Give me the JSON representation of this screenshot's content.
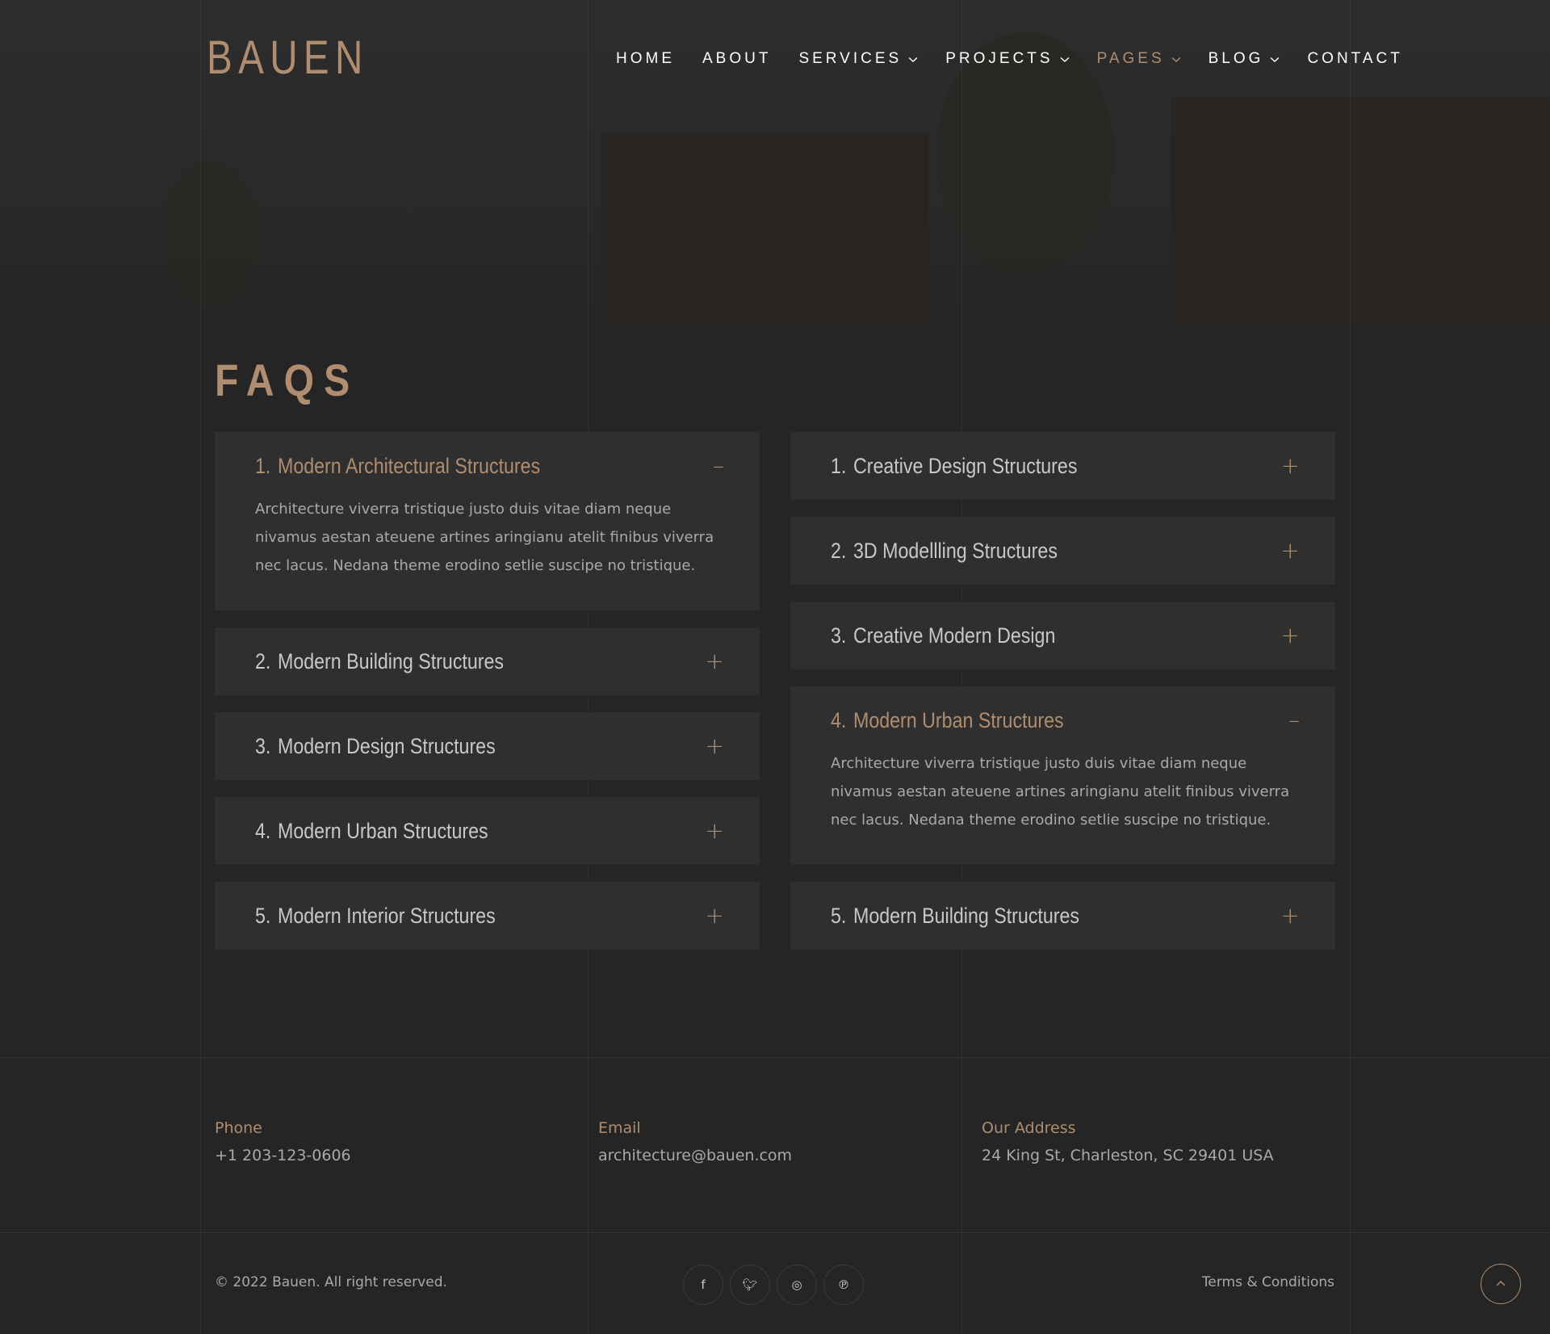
{
  "brand": {
    "logo": "BAUEN",
    "accent_color": "#b08d6e",
    "background_color": "#252525"
  },
  "nav": {
    "items": [
      {
        "label": "HOME",
        "has_dropdown": false,
        "active": false
      },
      {
        "label": "ABOUT",
        "has_dropdown": false,
        "active": false
      },
      {
        "label": "SERVICES",
        "has_dropdown": true,
        "active": false
      },
      {
        "label": "PROJECTS",
        "has_dropdown": true,
        "active": false
      },
      {
        "label": "PAGES",
        "has_dropdown": true,
        "active": true
      },
      {
        "label": "BLOG",
        "has_dropdown": true,
        "active": false
      },
      {
        "label": "CONTACT",
        "has_dropdown": false,
        "active": false
      }
    ],
    "dropdown_icon": "chevron-down-icon"
  },
  "faqs": {
    "title": "FAQS",
    "answer_text": "Architecture viverra tristique justo duis vitae diam neque nivamus aestan ateuene artines aringianu atelit finibus viverra nec lacus. Nedana theme erodino setlie suscipe no tristique.",
    "left": [
      {
        "num": "1.",
        "question": "Modern Architectural Structures",
        "open": true,
        "toggle": "–"
      },
      {
        "num": "2.",
        "question": "Modern Building Structures",
        "open": false,
        "toggle": "+"
      },
      {
        "num": "3.",
        "question": "Modern Design Structures",
        "open": false,
        "toggle": "+"
      },
      {
        "num": "4.",
        "question": "Modern Urban Structures",
        "open": false,
        "toggle": "+"
      },
      {
        "num": "5.",
        "question": "Modern Interior Structures",
        "open": false,
        "toggle": "+"
      }
    ],
    "right": [
      {
        "num": "1.",
        "question": "Creative Design Structures",
        "open": false,
        "toggle": "+"
      },
      {
        "num": "2.",
        "question": "3D Modellling Structures",
        "open": false,
        "toggle": "+"
      },
      {
        "num": "3.",
        "question": "Creative Modern Design",
        "open": false,
        "toggle": "+"
      },
      {
        "num": "4.",
        "question": "Modern Urban Structures",
        "open": true,
        "toggle": "–"
      },
      {
        "num": "5.",
        "question": "Modern Building Structures",
        "open": false,
        "toggle": "+"
      }
    ]
  },
  "footer": {
    "phone": {
      "label": "Phone",
      "value": "+1 203-123-0606"
    },
    "email": {
      "label": "Email",
      "value": "architecture@bauen.com"
    },
    "address": {
      "label": "Our Address",
      "value": "24  King St, Charleston, SC 29401 USA"
    },
    "copyright": "© 2022  Bauen. All right reserved.",
    "socials": [
      {
        "icon": "facebook-icon",
        "glyph": "f"
      },
      {
        "icon": "twitter-icon",
        "glyph": "🐦︎"
      },
      {
        "icon": "instagram-icon",
        "glyph": "◎"
      },
      {
        "icon": "pinterest-icon",
        "glyph": "℗"
      }
    ],
    "terms": "Terms & Conditions",
    "back_to_top_icon": "chevron-up-icon"
  }
}
